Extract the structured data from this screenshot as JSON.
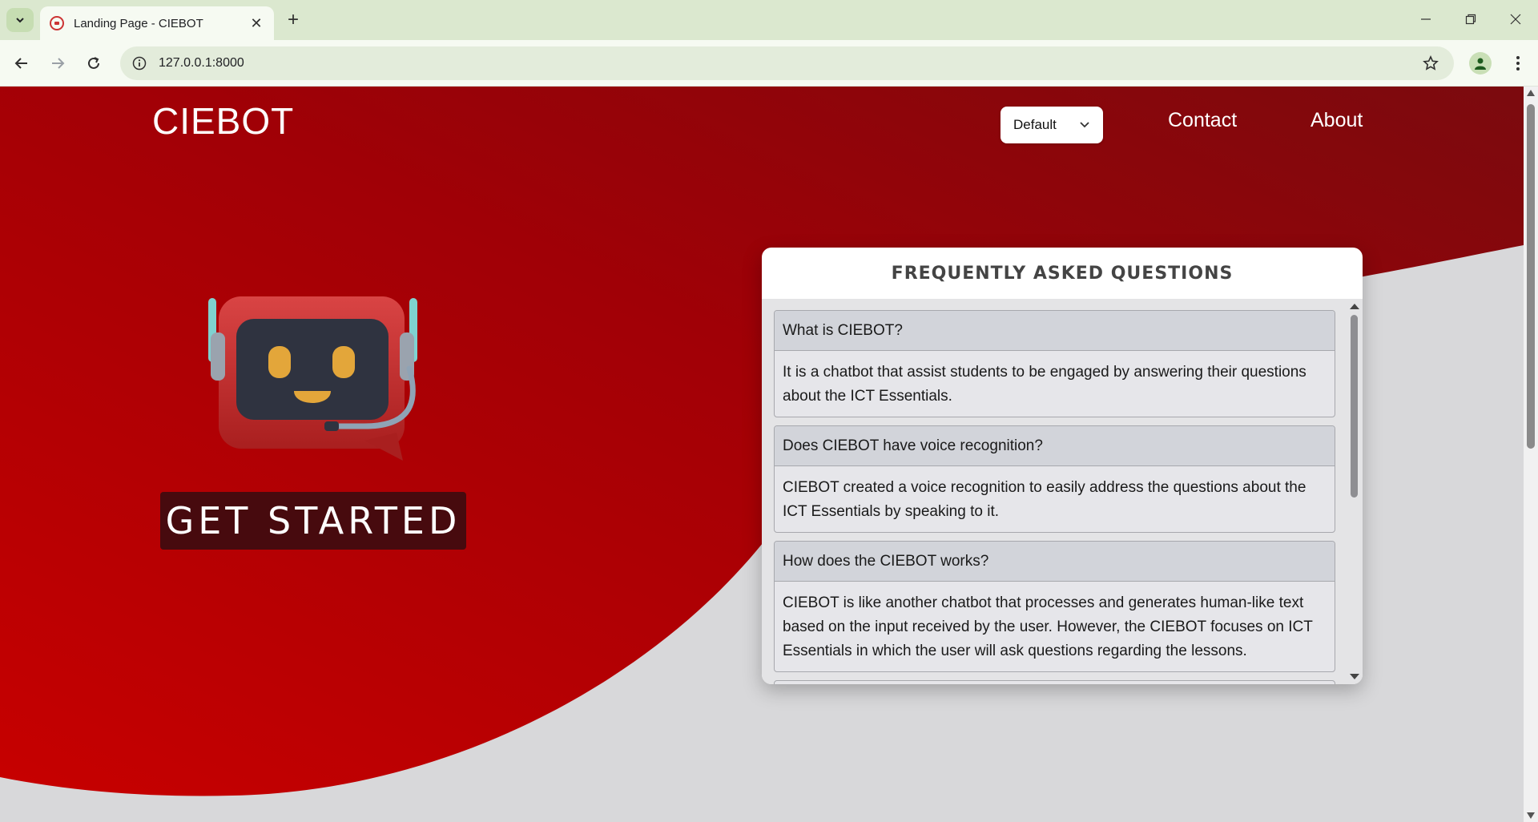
{
  "browser": {
    "tab_title": "Landing Page - CIEBOT",
    "url": "127.0.0.1:8000",
    "new_tab_label": "+",
    "tab_close_label": "✕"
  },
  "header": {
    "brand": "CIEBOT",
    "language_select": {
      "value": "Default"
    },
    "nav": {
      "contact": "Contact",
      "about": "About"
    }
  },
  "hero": {
    "cta_label": "GET STARTED"
  },
  "faq": {
    "title": "FREQUENTLY ASKED QUESTIONS",
    "items": [
      {
        "question": "What is CIEBOT?",
        "answer": "It is a chatbot that assist students to be engaged by answering their questions about the ICT Essentials."
      },
      {
        "question": "Does CIEBOT have voice recognition?",
        "answer": "CIEBOT created a voice recognition to easily address the questions about the ICT Essentials by speaking to it."
      },
      {
        "question": "How does the CIEBOT works?",
        "answer": "CIEBOT is like another chatbot that processes and generates human-like text based on the input received by the user. However, the CIEBOT focuses on ICT Essentials in which the user will ask questions regarding the lessons."
      }
    ]
  },
  "colors": {
    "hero_red": "#b80000",
    "hero_dark_red": "#7a0a0e",
    "cta_bg": "#470a0e",
    "browser_frame": "#dbe8cf"
  }
}
